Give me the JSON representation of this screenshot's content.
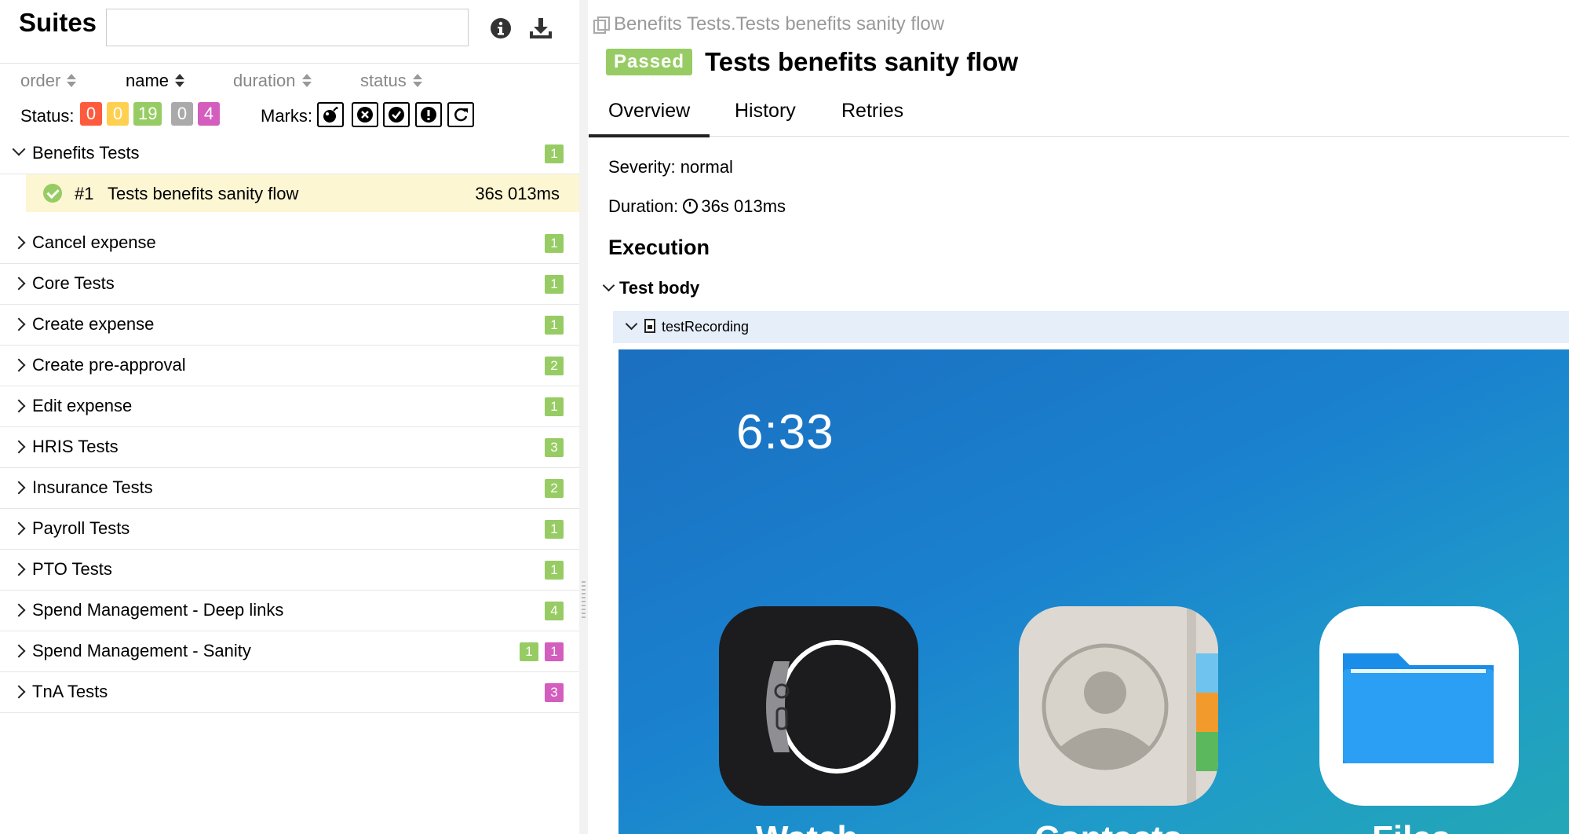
{
  "left": {
    "title": "Suites",
    "search": {
      "value": "",
      "placeholder": ""
    },
    "header_icons": [
      "info-icon",
      "download-icon"
    ],
    "sort_columns": [
      {
        "label": "order",
        "active": false
      },
      {
        "label": "name",
        "active": true
      },
      {
        "label": "duration",
        "active": false
      },
      {
        "label": "status",
        "active": false
      }
    ],
    "status_label": "Status:",
    "status_counts": [
      {
        "value": "0",
        "color": "#fd5a3e"
      },
      {
        "value": "0",
        "color": "#ffd050"
      },
      {
        "value": "19",
        "color": "#97cc64"
      },
      {
        "value": "0",
        "color": "#aaaaaa"
      },
      {
        "value": "4",
        "color": "#d35ebe"
      }
    ],
    "marks_label": "Marks:",
    "marks": [
      "bomb-icon",
      "close-circle-icon",
      "check-circle-icon",
      "exclamation-icon",
      "refresh-icon"
    ],
    "groups": [
      {
        "name": "Benefits Tests",
        "expanded": true,
        "counts": [
          {
            "value": "1",
            "color": "#97cc64"
          }
        ],
        "tests": [
          {
            "num": "#1",
            "name": "Tests benefits sanity flow",
            "duration": "36s 013ms",
            "status": "passed"
          }
        ]
      },
      {
        "name": "Cancel expense",
        "counts": [
          {
            "value": "1",
            "color": "#97cc64"
          }
        ]
      },
      {
        "name": "Core Tests",
        "counts": [
          {
            "value": "1",
            "color": "#97cc64"
          }
        ]
      },
      {
        "name": "Create expense",
        "counts": [
          {
            "value": "1",
            "color": "#97cc64"
          }
        ]
      },
      {
        "name": "Create pre-approval",
        "counts": [
          {
            "value": "2",
            "color": "#97cc64"
          }
        ]
      },
      {
        "name": "Edit expense",
        "counts": [
          {
            "value": "1",
            "color": "#97cc64"
          }
        ]
      },
      {
        "name": "HRIS Tests",
        "counts": [
          {
            "value": "3",
            "color": "#97cc64"
          }
        ]
      },
      {
        "name": "Insurance Tests",
        "counts": [
          {
            "value": "2",
            "color": "#97cc64"
          }
        ]
      },
      {
        "name": "Payroll Tests",
        "counts": [
          {
            "value": "1",
            "color": "#97cc64"
          }
        ]
      },
      {
        "name": "PTO Tests",
        "counts": [
          {
            "value": "1",
            "color": "#97cc64"
          }
        ]
      },
      {
        "name": "Spend Management - Deep links",
        "counts": [
          {
            "value": "4",
            "color": "#97cc64"
          }
        ]
      },
      {
        "name": "Spend Management - Sanity",
        "counts": [
          {
            "value": "1",
            "color": "#97cc64"
          },
          {
            "value": "1",
            "color": "#d35ebe"
          }
        ]
      },
      {
        "name": "TnA Tests",
        "counts": [
          {
            "value": "3",
            "color": "#d35ebe"
          }
        ]
      }
    ]
  },
  "right": {
    "breadcrumb": "Benefits Tests.Tests benefits sanity flow",
    "status_badge": "Passed",
    "test_title": "Tests benefits sanity flow",
    "tabs": [
      {
        "label": "Overview",
        "active": true
      },
      {
        "label": "History",
        "active": false
      },
      {
        "label": "Retries",
        "active": false
      }
    ],
    "severity": "Severity: normal",
    "duration_label": "Duration:",
    "duration_value": "36s 013ms",
    "execution_title": "Execution",
    "test_body_label": "Test body",
    "attachment_name": "testRecording",
    "video": {
      "time": "6:33",
      "apps": [
        "Watch",
        "Contacts",
        "Files"
      ]
    }
  }
}
